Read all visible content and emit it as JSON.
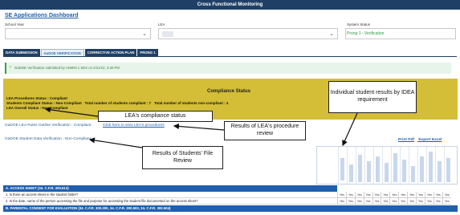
{
  "header": {
    "title": "Cross Functional Monitoring"
  },
  "dashboard_link": "SE Applications Dashboard",
  "filters": {
    "school_year_label": "School Year",
    "lea_label": "LEA",
    "system_status_label": "System Status",
    "system_status_value": "Prong 1 - Verification"
  },
  "tabs": [
    "DATA SUBMISSION",
    "GaDOE VERIFICATION",
    "CORRECTIVE ACTION PLAN",
    "PRONG 1"
  ],
  "alert": {
    "text": "GaDOE Verification submitted by ADMIN 1 SES on 2/21/22, 4:30 PM"
  },
  "compliance": {
    "title": "Compliance Status",
    "lea_procedures_status": "LEA Procedures Status : Compliant",
    "students_compliant_status": "Students Compliant Status : Non-Compliant",
    "num_compliant": "Total number of students compliant : 7",
    "num_noncompliant": "Total number of students non-compliant : 4",
    "lea_overall_status": "LEA Overall Status : Non-Compliant"
  },
  "rows": {
    "lea_rules": "GaDOE LEA Rules Outline Verification : Compliant",
    "view_procedures_link": "Click here to view LEA's procedures",
    "student_data": "GaDOE Student Data Verification : Non-Compliant",
    "print_pdf": "Print Pdf",
    "export_excel": "Export Excel"
  },
  "sections": {
    "access_sheet": "A. ACCESS SHEET (34. C.F.R. 300.613)",
    "q1": "1. Is there an access sheet in the student folder?",
    "q2": "2. Is the date, name of the person accessing the file and purpose for accessing the student file documented on the access sheet?",
    "parental_consent": "B. PARENTAL CONSENT FOR EVALUATION (34. C.F.R. 300.300, 34. C.F.R. 300.503, 34. C.F.R. 300.504)"
  },
  "yes_values": {
    "row1": [
      "Yes",
      "Yes",
      "Yes",
      "Yes",
      "Yes",
      "Yes",
      "Yes",
      "Yes",
      "Yes",
      "Yes",
      "Yes",
      "Yes",
      "Yes"
    ],
    "row2": [
      "Yes",
      "Yes",
      "Yes",
      "Yes",
      "Yes",
      "Yes",
      "Yes",
      "Yes",
      "Yes",
      "Yes",
      "Yes",
      "Yes",
      "Yes"
    ]
  },
  "callouts": {
    "lea_status": "LEA's compliance status",
    "lea_procedures": "Results of LEA's procedure review",
    "students_file": "Results of Students' File Review",
    "individual": "Individual student results by IDEA requirement"
  },
  "colors": {
    "navy": "#1f3f66",
    "compliance_bg": "#d4be37",
    "link": "#1f5fae",
    "success": "#2e9b40"
  }
}
